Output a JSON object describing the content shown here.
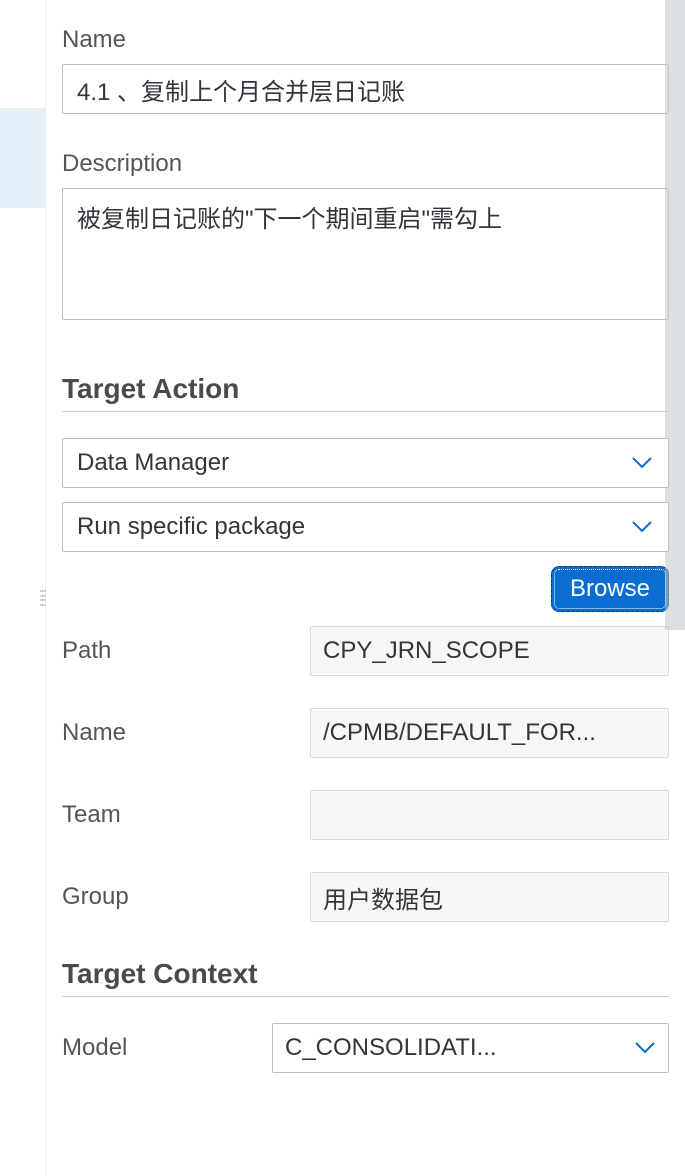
{
  "form": {
    "name_label": "Name",
    "name_value": "4.1 、复制上个月合并层日记账",
    "description_label": "Description",
    "description_value": "被复制日记账的\"下一个期间重启\"需勾上"
  },
  "target_action": {
    "title": "Target Action",
    "type_value": "Data Manager",
    "mode_value": "Run specific package",
    "browse_label": "Browse",
    "path_label": "Path",
    "path_value": "CPY_JRN_SCOPE",
    "name_label": "Name",
    "name_value": "/CPMB/DEFAULT_FOR...",
    "team_label": "Team",
    "team_value": "",
    "group_label": "Group",
    "group_value": "用户数据包"
  },
  "target_context": {
    "title": "Target Context",
    "model_label": "Model",
    "model_value": "C_CONSOLIDATI..."
  }
}
